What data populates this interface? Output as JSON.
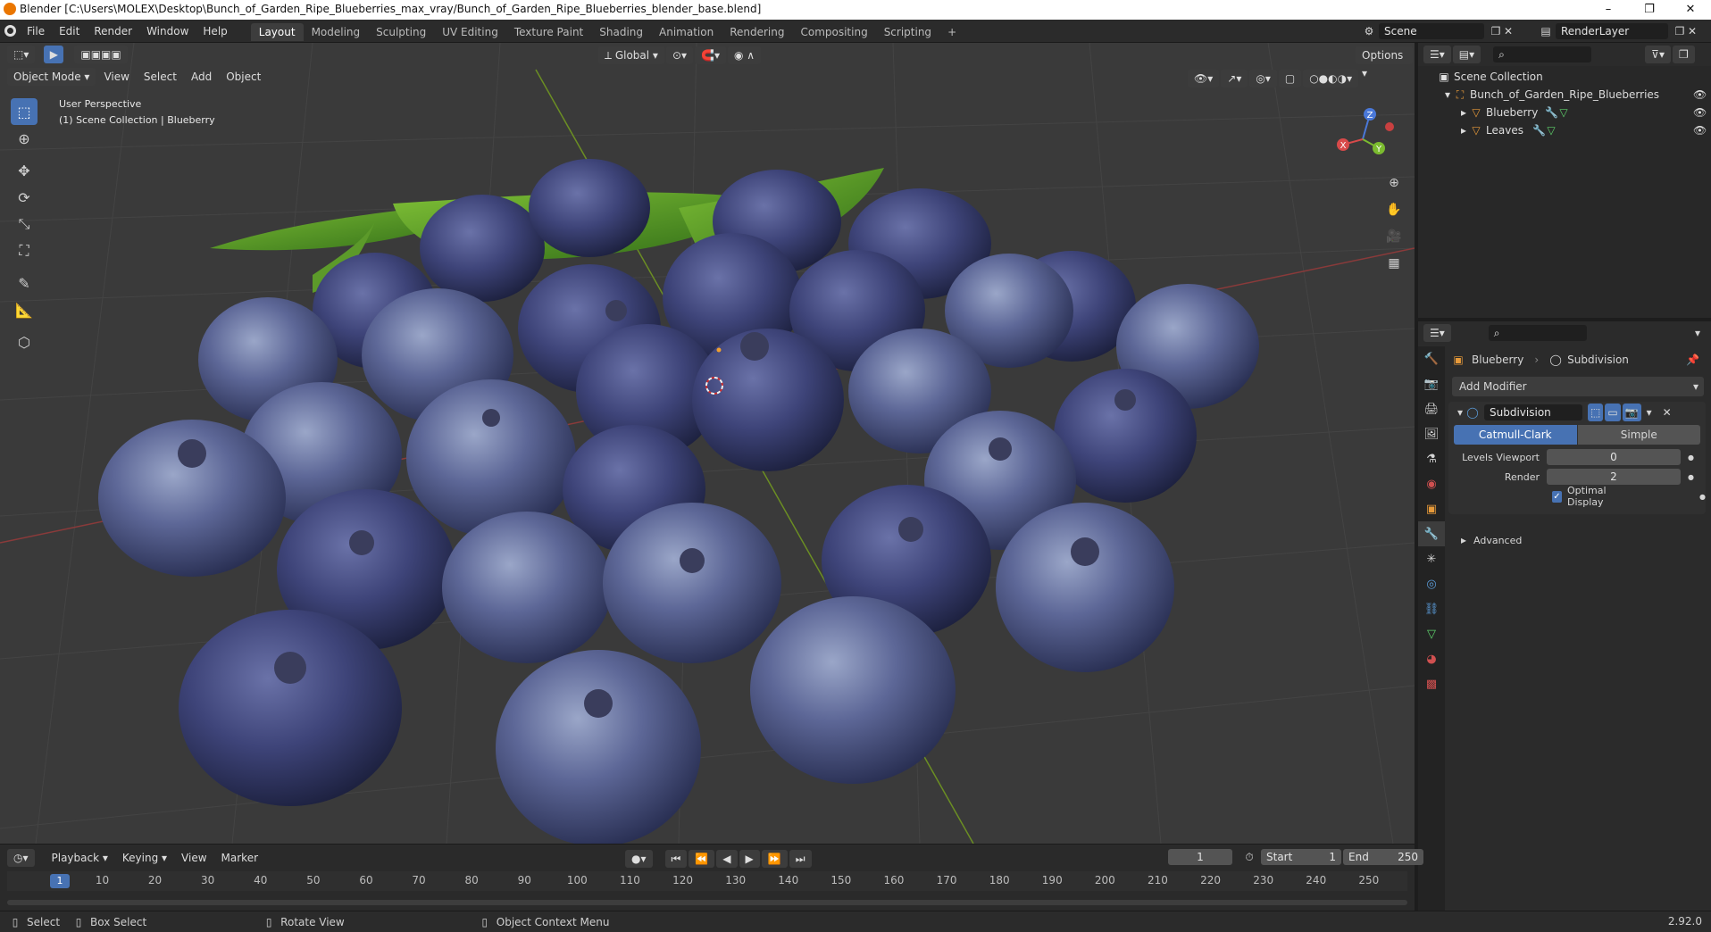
{
  "window": {
    "title": "Blender [C:\\Users\\MOLEX\\Desktop\\Bunch_of_Garden_Ripe_Blueberries_max_vray/Bunch_of_Garden_Ripe_Blueberries_blender_base.blend]",
    "minimize": "–",
    "restore": "❐",
    "close": "✕"
  },
  "menus": [
    "File",
    "Edit",
    "Render",
    "Window",
    "Help"
  ],
  "workspaces": [
    "Layout",
    "Modeling",
    "Sculpting",
    "UV Editing",
    "Texture Paint",
    "Shading",
    "Animation",
    "Rendering",
    "Compositing",
    "Scripting"
  ],
  "workspace_add": "+",
  "scene": "Scene",
  "render_layer": "RenderLayer",
  "viewport": {
    "mode": "Object Mode",
    "menus": [
      "View",
      "Select",
      "Add",
      "Object"
    ],
    "orientation": "Global",
    "options": "Options",
    "overlay_line1": "User Perspective",
    "overlay_line2": "(1) Scene Collection | Blueberry",
    "gizmo": {
      "z": "Z",
      "y": "Y",
      "x": "X"
    }
  },
  "outliner": {
    "root": "Scene Collection",
    "collection": "Bunch_of_Garden_Ripe_Blueberries",
    "items": [
      "Blueberry",
      "Leaves"
    ]
  },
  "properties": {
    "object": "Blueberry",
    "modifier_crumb": "Subdivision",
    "add_modifier": "Add Modifier",
    "modifier_name": "Subdivision",
    "modes": [
      "Catmull-Clark",
      "Simple"
    ],
    "levels_viewport_label": "Levels Viewport",
    "levels_viewport": "0",
    "render_label": "Render",
    "render_value": "2",
    "optimal_display": "Optimal Display",
    "optimal_display_checked": true,
    "advanced": "Advanced"
  },
  "timeline": {
    "menus": [
      "Playback",
      "Keying",
      "View",
      "Marker"
    ],
    "current_frame": "1",
    "start_label": "Start",
    "start": "1",
    "end_label": "End",
    "end": "250",
    "ticks": [
      "10",
      "20",
      "30",
      "40",
      "50",
      "60",
      "70",
      "80",
      "90",
      "100",
      "110",
      "120",
      "130",
      "140",
      "150",
      "160",
      "170",
      "180",
      "190",
      "200",
      "210",
      "220",
      "230",
      "240",
      "250"
    ],
    "playhead": "1"
  },
  "statusbar": {
    "select": "Select",
    "box_select": "Box Select",
    "rotate_view": "Rotate View",
    "context_menu": "Object Context Menu",
    "version": "2.92.0"
  },
  "colors": {
    "accent": "#4772b3",
    "orange": "#ea7600",
    "berry": "#5a5f95"
  }
}
